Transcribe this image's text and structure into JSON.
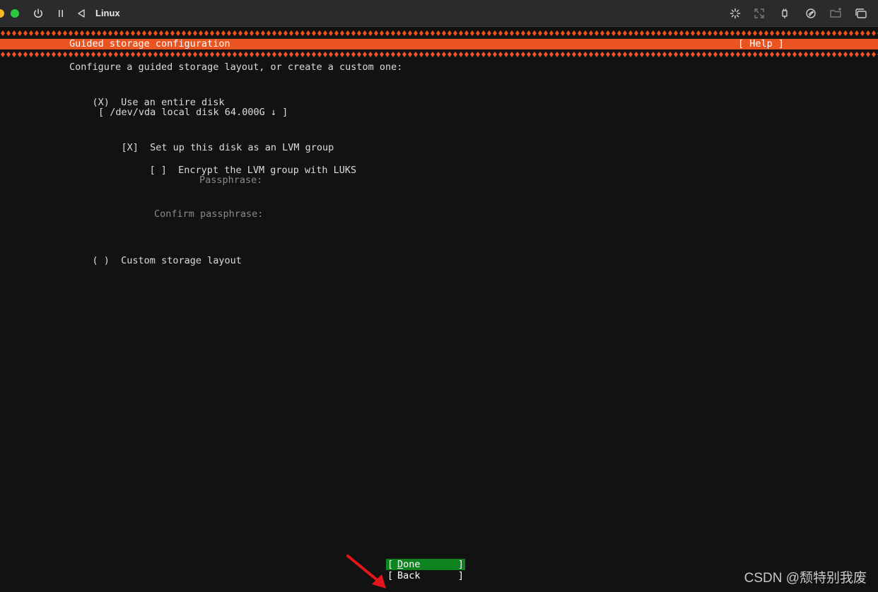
{
  "window": {
    "title": "Linux",
    "toolbar_icons": [
      "power-icon",
      "pause-icon",
      "back-icon",
      "loading-icon",
      "fullscreen-icon",
      "usb-icon",
      "network-icon",
      "folder-icon",
      "windows-icon"
    ]
  },
  "installer": {
    "header_title": "Guided storage configuration",
    "help_label": "[ Help ]",
    "intro": "Configure a guided storage layout, or create a custom one:",
    "use_entire_disk": {
      "marker": "(X)",
      "label": "Use an entire disk"
    },
    "disk_select": "[ /dev/vda local disk 64.000G ↓ ]",
    "lvm": {
      "marker": "[X]",
      "label": "Set up this disk as an LVM group"
    },
    "encrypt": {
      "marker": "[ ]",
      "label": "Encrypt the LVM group with LUKS"
    },
    "passphrase_label": "Passphrase:",
    "confirm_passphrase_label": "Confirm passphrase:",
    "custom_layout": {
      "marker": "( )",
      "label": "Custom storage layout"
    },
    "buttons": {
      "done": "Done",
      "back": "Back",
      "bracket_open": "[",
      "bracket_close": "]"
    }
  },
  "watermark": "CSDN @颓特别我废",
  "colors": {
    "accent_orange": "#e95420",
    "button_green": "#0e8420",
    "background": "#121212",
    "arrow_red": "#e8141c"
  }
}
